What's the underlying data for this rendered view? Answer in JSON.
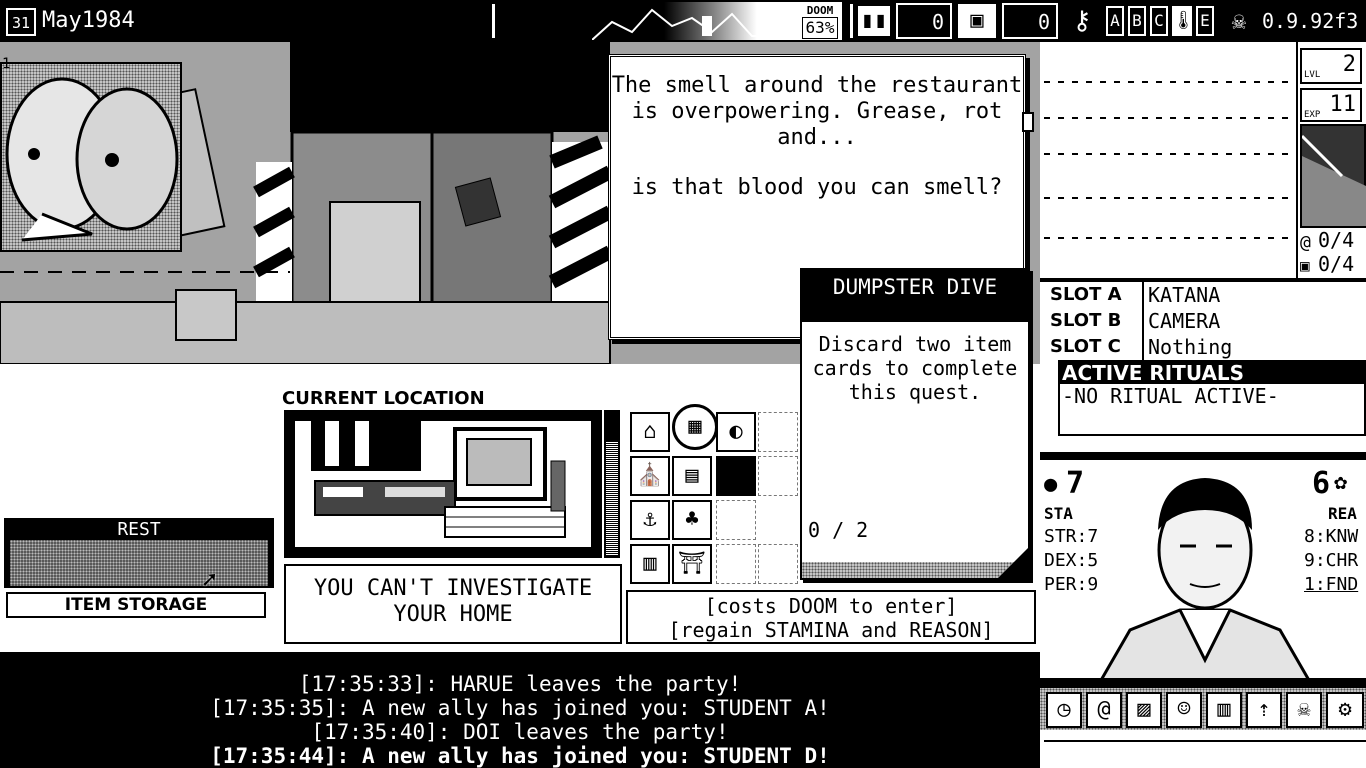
{
  "topbar": {
    "date": "May1984",
    "calendar_day": "31",
    "doom_label": "DOOM",
    "doom_value": "63%",
    "cards_count": "0",
    "storage_count": "0",
    "letters": [
      "A",
      "B",
      "C",
      "E"
    ],
    "version": "0.9.92f3"
  },
  "dialog": {
    "line1": "The smell around the restaurant",
    "line2": "is overpowering. Grease, rot",
    "line3": "and...",
    "line4": "is that blood you can smell?"
  },
  "quest": {
    "title": "DUMPSTER DIVE",
    "line1": "Discard two item",
    "line2": "cards to complete",
    "line3": "this quest.",
    "progress": "0 / 2"
  },
  "location": {
    "header": "CURRENT LOCATION",
    "message_line1": "YOU CAN'T INVESTIGATE",
    "message_line2": "YOUR HOME",
    "rest_label": "REST",
    "storage_label": "ITEM STORAGE",
    "rest_info_line1": "[costs DOOM to enter]",
    "rest_info_line2": "[regain STAMINA and REASON]"
  },
  "log": [
    "[17:35:33]: HARUE leaves the party!",
    "[17:35:35]: A new ally has joined you: STUDENT A!",
    "[17:35:40]: DOI leaves the party!",
    "[17:35:44]: A new ally has joined you: STUDENT D!"
  ],
  "character": {
    "lvl_label": "LVL",
    "lvl": "2",
    "exp_label": "EXP",
    "exp": "11",
    "spiral_count": "0/4",
    "bag_count": "0/4",
    "slots": [
      {
        "label": "SLOT A",
        "value": "KATANA"
      },
      {
        "label": "SLOT B",
        "value": "CAMERA"
      },
      {
        "label": "SLOT C",
        "value": "Nothing"
      }
    ],
    "rituals_header": "ACTIVE RITUALS",
    "rituals_value": "-NO RITUAL ACTIVE-",
    "sta_value": "7",
    "sta_label": "STA",
    "rea_value": "6",
    "rea_label": "REA",
    "stats_left": [
      "STR:7",
      "DEX:5",
      "PER:9"
    ],
    "stats_right": [
      "8:KNW",
      "9:CHR",
      "1:FND"
    ]
  },
  "corner_marker": "1"
}
